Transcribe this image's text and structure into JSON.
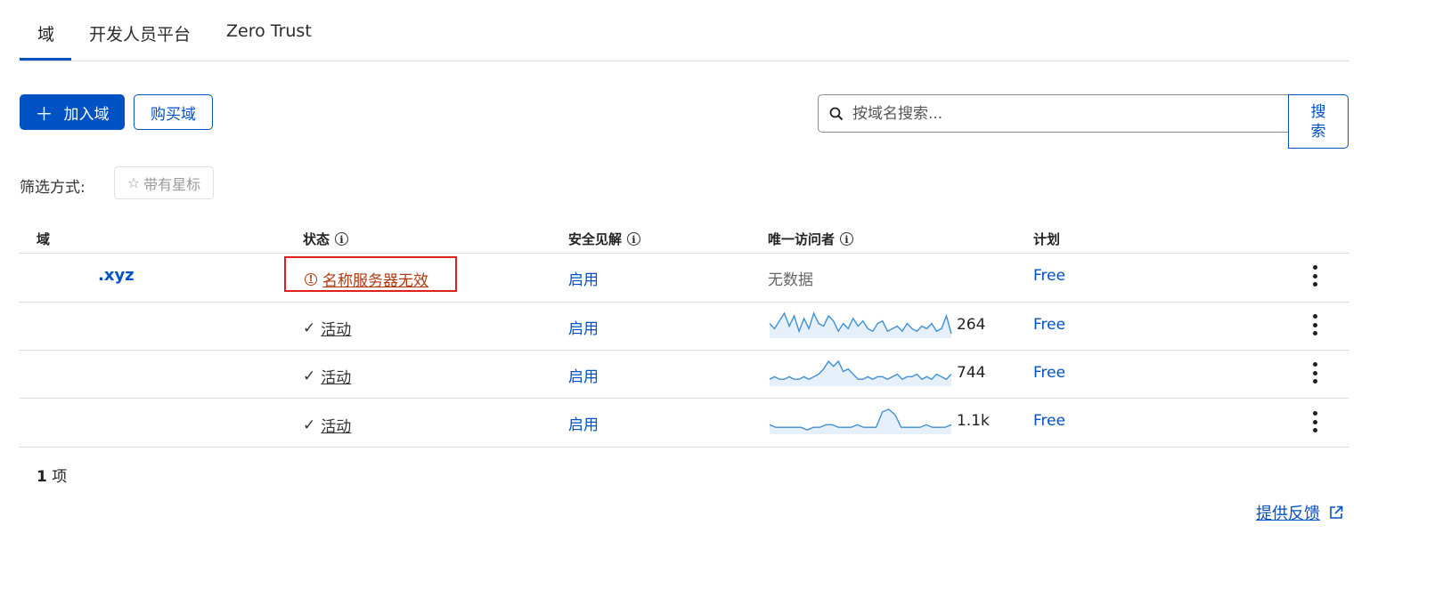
{
  "tabs": [
    {
      "label": "域",
      "active": true
    },
    {
      "label": "开发人员平台",
      "active": false
    },
    {
      "label": "Zero Trust",
      "active": false
    }
  ],
  "toolbar": {
    "add_domain_label": "加入域",
    "buy_domain_label": "购买域",
    "search_placeholder": "按域名搜索...",
    "search_button_label": "搜索"
  },
  "filter": {
    "label": "筛选方式:",
    "starred_label": "带有星标"
  },
  "table": {
    "headers": {
      "domain": "域",
      "status": "状态",
      "security": "安全见解",
      "visitors": "唯一访问者",
      "plan": "计划"
    },
    "rows": [
      {
        "domain": ".xyz",
        "status": "名称服务器无效",
        "status_type": "invalid",
        "security": "启用",
        "visitors": "无数据",
        "plan": "Free"
      },
      {
        "domain": "",
        "status": "活动",
        "status_type": "active",
        "security": "启用",
        "visitors": "264",
        "plan": "Free",
        "sparkline": [
          5,
          3,
          6,
          9,
          4,
          8,
          2,
          7,
          3,
          9,
          5,
          4,
          8,
          6,
          2,
          5,
          3,
          7,
          4,
          6,
          3,
          2,
          5,
          6,
          2,
          3,
          4,
          2,
          5,
          3,
          2,
          4,
          3,
          5,
          2,
          3,
          8,
          1
        ]
      },
      {
        "domain": "",
        "status": "活动",
        "status_type": "active",
        "security": "启用",
        "visitors": "744",
        "plan": "Free",
        "sparkline": [
          2,
          3,
          2,
          2,
          3,
          2,
          2,
          3,
          2,
          3,
          4,
          6,
          9,
          7,
          9,
          5,
          6,
          4,
          2,
          2,
          3,
          2,
          3,
          3,
          2,
          3,
          4,
          2,
          3,
          3,
          4,
          2,
          3,
          2,
          4,
          3,
          2,
          4
        ]
      },
      {
        "domain": "",
        "status": "活动",
        "status_type": "active",
        "security": "启用",
        "visitors": "1.1k",
        "plan": "Free",
        "sparkline": [
          3,
          2,
          2,
          2,
          2,
          2,
          1,
          2,
          2,
          3,
          3,
          2,
          2,
          2,
          3,
          2,
          2,
          2,
          8,
          9,
          7,
          2,
          2,
          2,
          2,
          3,
          2,
          2,
          2,
          3
        ]
      }
    ]
  },
  "footer": {
    "count_number": "1",
    "count_unit": "项",
    "feedback_label": "提供反馈"
  },
  "colors": {
    "accent": "#0051c3",
    "error": "#b03a10",
    "highlight": "#e0201b",
    "sparkline_stroke": "#3d8fd6",
    "sparkline_fill": "#e6f0fb"
  }
}
